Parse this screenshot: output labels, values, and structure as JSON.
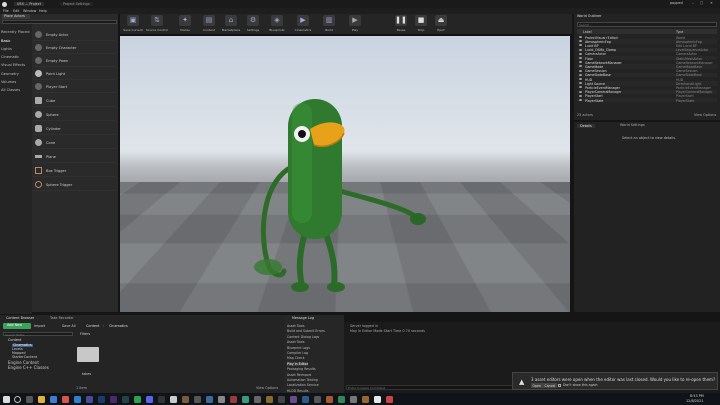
{
  "window": {
    "title": "UE4 — Project",
    "tab": "Project Settings"
  },
  "menu": [
    "File",
    "Edit",
    "Window",
    "Help"
  ],
  "user": "popped",
  "toolbar": [
    {
      "label": "Save Current",
      "icon": "save-icon"
    },
    {
      "label": "Source Control",
      "icon": "source-control-icon"
    },
    {
      "label": "Modes",
      "icon": "modes-icon"
    },
    {
      "label": "Content",
      "icon": "content-icon"
    },
    {
      "label": "Marketplace",
      "icon": "marketplace-icon"
    },
    {
      "label": "Settings",
      "icon": "gear-icon"
    },
    {
      "label": "Blueprints",
      "icon": "blueprint-icon"
    },
    {
      "label": "Cinematics",
      "icon": "cinematics-icon"
    },
    {
      "label": "Build",
      "icon": "build-icon"
    },
    {
      "label": "Play",
      "icon": "play-icon"
    },
    {
      "label": "Pause",
      "icon": "pause-icon"
    },
    {
      "label": "Stop",
      "icon": "stop-icon"
    },
    {
      "label": "Eject",
      "icon": "eject-icon"
    }
  ],
  "modes": {
    "tab": "Place Actors",
    "search_placeholder": "Search Classes"
  },
  "categories": [
    "Recently Placed",
    "Basic",
    "Lights",
    "Cinematic",
    "Visual Effects",
    "Geometry",
    "Volumes",
    "All Classes"
  ],
  "actors": [
    "Empty Actor",
    "Empty Character",
    "Empty Pawn",
    "Point Light",
    "Player Start",
    "Cube",
    "Sphere",
    "Cylinder",
    "Cone",
    "Plane",
    "Box Trigger",
    "Sphere Trigger"
  ],
  "outliner": {
    "tab": "World Outliner",
    "search_placeholder": "Search...",
    "col_label": "Label",
    "col_type": "Type",
    "rows": [
      {
        "label": "ProjectVisual (Editor)",
        "type": "World"
      },
      {
        "label": "AtmosphericFog",
        "type": "AtmosphericFog"
      },
      {
        "label": "Lucid BP",
        "type": "Edit Lucid BP"
      },
      {
        "label": "Lucid_OSMo_Clamp",
        "type": "LevelSequenceActor"
      },
      {
        "label": "CameraActor",
        "type": "CameraActor"
      },
      {
        "label": "Floor",
        "type": "StaticMeshActor"
      },
      {
        "label": "GameNetworkManager",
        "type": "GameNetworkManager"
      },
      {
        "label": "GameMode",
        "type": "GameModeBase"
      },
      {
        "label": "GameSession",
        "type": "GameSession"
      },
      {
        "label": "GameStateBase",
        "type": "GameStateBase"
      },
      {
        "label": "HUD",
        "type": "HUD"
      },
      {
        "label": "Light Source",
        "type": "DirectionalLight"
      },
      {
        "label": "ParticleEventManager",
        "type": "ParticleEventManager"
      },
      {
        "label": "PlayerCameraManager",
        "type": "PlayerCameraManager"
      },
      {
        "label": "PlayerStart",
        "type": "PlayerStart"
      },
      {
        "label": "PlayerState",
        "type": "PlayerState"
      }
    ],
    "count": "23 actors",
    "view_options": "View Options"
  },
  "details": {
    "tab_details": "Details",
    "tab_world": "World Settings",
    "empty": "Select an object to view details."
  },
  "content": {
    "tab_browser": "Content Browser",
    "tab_take": "Take Recorder",
    "add_new": "Add New",
    "import": "Import",
    "save_all": "Save All",
    "path_root": "Content",
    "path_sub": "Cinematics",
    "search_placeholder": "Search Paths",
    "filters": "Filters",
    "tree": [
      "Content",
      "Cinematics",
      "Levels",
      "Mapped",
      "StarterContent"
    ],
    "engine": [
      "Engine Content",
      "Engine C++ Classes"
    ],
    "folder": "takes",
    "count": "1 item",
    "view_options": "View Options"
  },
  "msglog": {
    "tab": "Message Log",
    "items": [
      "Asset Tools",
      "Build and Submit Errors",
      "Content Dialog Logs",
      "Asset Tools",
      "Blueprint Logs",
      "Compiler Log",
      "Map Check",
      "Play In Editor",
      "Packaging Results",
      "Asset Reimport",
      "Automation Testing",
      "Localization Service",
      "HLOD Results"
    ]
  },
  "output": {
    "lines": [
      "Server logged in",
      "May in Editor Mode Start Time 0.70 seconds"
    ],
    "placeholder": "Enter Console Command"
  },
  "notification": {
    "text": "3 asset editors were open when the editor was last closed. Would you like to re-open them?",
    "btn_open": "Open",
    "btn_cancel": "Cancel",
    "dont_show": "Don't show this again"
  },
  "taskbar": {
    "time": "8:53 PM",
    "date": "12/8/2021"
  },
  "colors": {
    "accent": "#3ca15a",
    "bird": "#2f7a2e",
    "beak": "#e8a21a"
  }
}
